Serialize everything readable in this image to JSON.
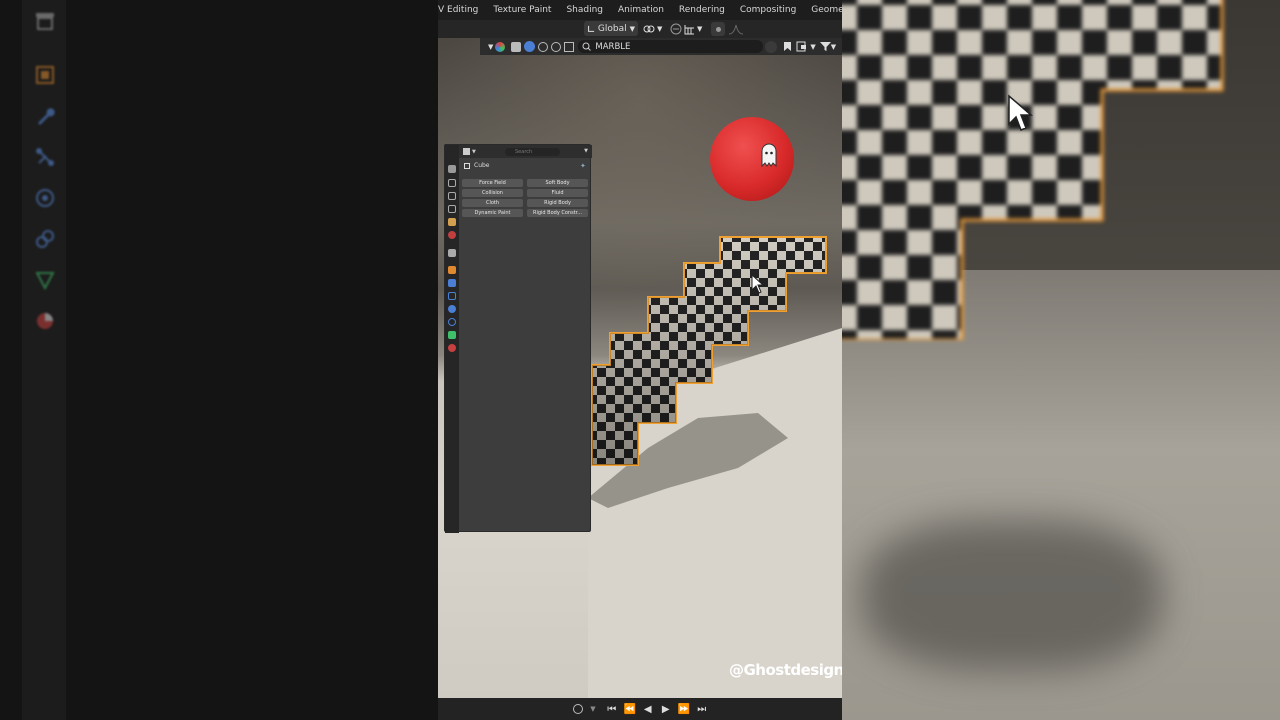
{
  "workspace_tabs": [
    "V Editing",
    "Texture Paint",
    "Shading",
    "Animation",
    "Rendering",
    "Compositing",
    "Geometry Nodes"
  ],
  "header": {
    "transform_orientation": "Global"
  },
  "outliner_filter": {
    "search_value": "MARBLE"
  },
  "properties_panel": {
    "search_placeholder": "Search",
    "object_name": "Cube",
    "physics_buttons": [
      {
        "label": "Force Field"
      },
      {
        "label": "Soft Body"
      },
      {
        "label": "Collision"
      },
      {
        "label": "Fluid"
      },
      {
        "label": "Cloth"
      },
      {
        "label": "Rigid Body"
      },
      {
        "label": "Dynamic Paint"
      },
      {
        "label": "Rigid Body Constr..."
      }
    ]
  },
  "watermark": "@Ghostdesigner",
  "colors": {
    "selection_outline": "#f0a030",
    "ball": "#d92a2a",
    "accent_blue": "#4a7fd4"
  },
  "icons": [
    "archive-icon",
    "object-icon",
    "wrench-icon",
    "particles-icon",
    "physics-icon",
    "constraints-icon",
    "data-icon",
    "material-icon"
  ]
}
